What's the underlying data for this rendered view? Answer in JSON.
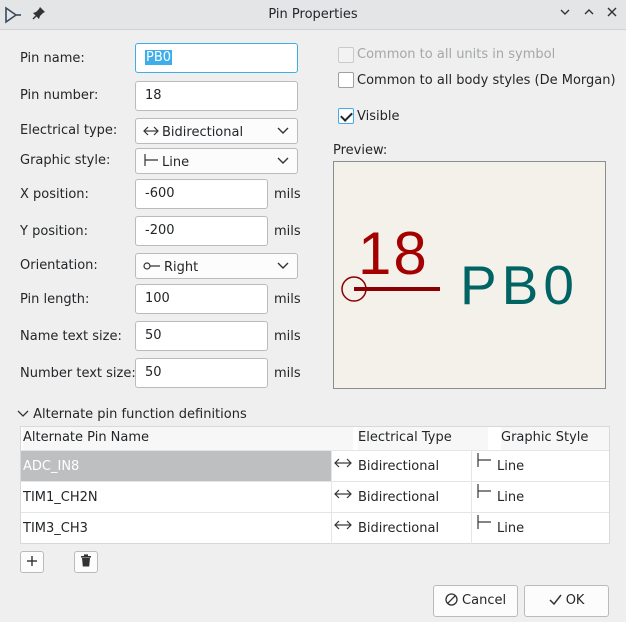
{
  "window": {
    "title": "Pin Properties"
  },
  "form": {
    "pin_name_label": "Pin name:",
    "pin_name_value": "PB0",
    "pin_number_label": "Pin number:",
    "pin_number_value": "18",
    "electrical_type_label": "Electrical type:",
    "electrical_type_value": "Bidirectional",
    "graphic_style_label": "Graphic style:",
    "graphic_style_value": "Line",
    "x_position_label": "X position:",
    "x_position_value": "-600",
    "y_position_label": "Y position:",
    "y_position_value": "-200",
    "orientation_label": "Orientation:",
    "orientation_value": "Right",
    "pin_length_label": "Pin length:",
    "pin_length_value": "100",
    "name_text_size_label": "Name text size:",
    "name_text_size_value": "50",
    "number_text_size_label": "Number text size:",
    "number_text_size_value": "50",
    "unit": "mils"
  },
  "options": {
    "common_units_label": "Common to all units in symbol",
    "common_units_checked": false,
    "common_units_enabled": false,
    "common_body_label": "Common to all body styles (De Morgan)",
    "common_body_checked": false,
    "visible_label": "Visible",
    "visible_checked": true
  },
  "preview": {
    "label": "Preview:",
    "pin_number": "18",
    "pin_name": "PB0"
  },
  "alternates": {
    "section_label": "Alternate pin function definitions",
    "columns": [
      "Alternate Pin Name",
      "Electrical Type",
      "Graphic Style"
    ],
    "rows": [
      {
        "name": "ADC_IN8",
        "type": "Bidirectional",
        "style": "Line",
        "selected": true
      },
      {
        "name": "TIM1_CH2N",
        "type": "Bidirectional",
        "style": "Line",
        "selected": false
      },
      {
        "name": "TIM3_CH3",
        "type": "Bidirectional",
        "style": "Line",
        "selected": false
      }
    ]
  },
  "buttons": {
    "cancel": "Cancel",
    "ok": "OK"
  },
  "colors": {
    "accent": "#3daee9",
    "pin_number_color": "#a40000",
    "pin_name_color": "#006464",
    "pin_line_color": "#8b0000",
    "preview_bg": "#f4f1ea"
  }
}
